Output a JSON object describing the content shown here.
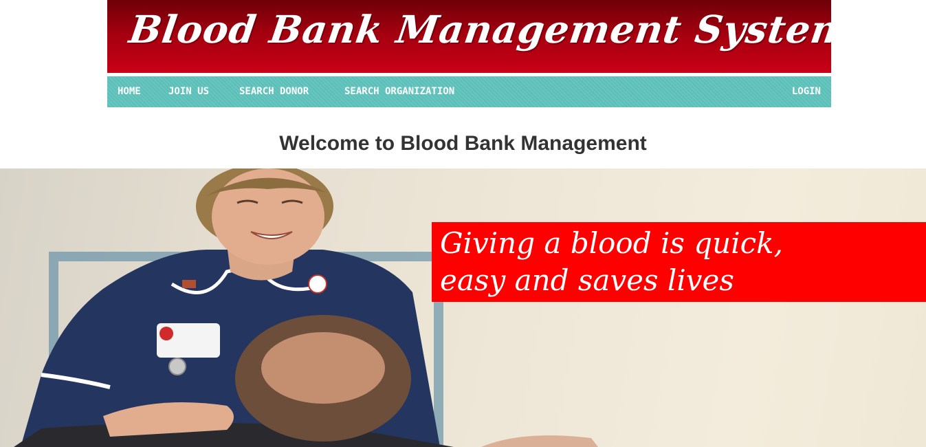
{
  "header": {
    "title": "Blood Bank Management System"
  },
  "nav": {
    "items": [
      {
        "label": "HOME"
      },
      {
        "label": "JOIN US"
      },
      {
        "label": "SEARCH DONOR"
      },
      {
        "label": "SEARCH ORGANIZATION"
      }
    ],
    "login_label": "LOGIN"
  },
  "main": {
    "welcome": "Welcome to Blood Bank Management"
  },
  "hero": {
    "slogan_line1": "Giving a blood is quick,",
    "slogan_line2": "easy and saves lives",
    "image": "nurse-with-blood-donor-photo"
  },
  "colors": {
    "banner": "#b00012",
    "navbar": "#5fc4bd",
    "slogan_box": "#ff0000"
  }
}
